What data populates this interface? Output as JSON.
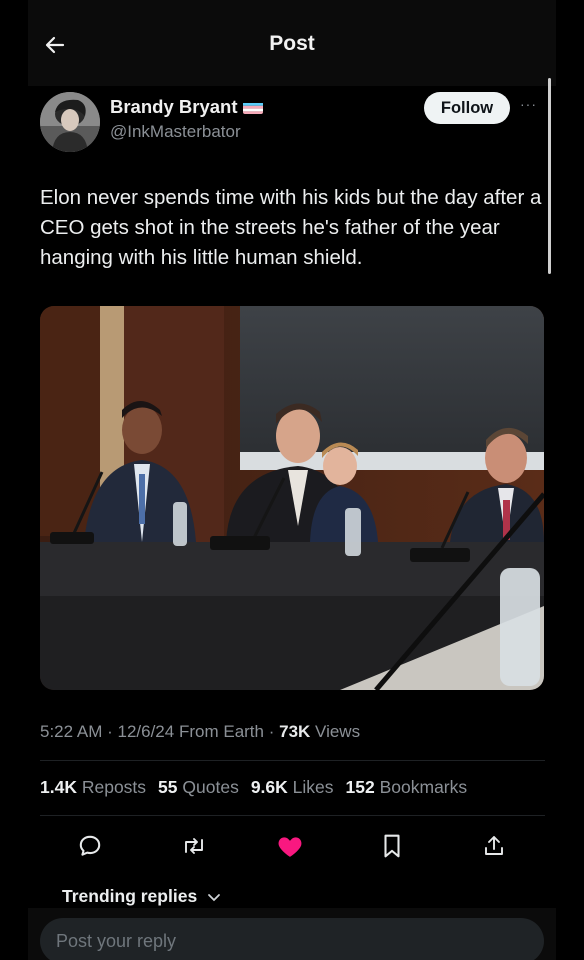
{
  "header": {
    "title": "Post"
  },
  "author": {
    "name": "Brandy Bryant",
    "handle": "@InkMasterbator",
    "follow_label": "Follow",
    "more_label": "···"
  },
  "tweet": {
    "text": "Elon never spends time with his kids but the day after a CEO gets shot in the streets he's father of the year hanging with his little human shield."
  },
  "meta": {
    "time": "5:22 AM",
    "date": "12/6/24",
    "source": "From Earth",
    "views_count": "73K",
    "views_label": "Views"
  },
  "stats": [
    {
      "count": "1.4K",
      "label": "Reposts"
    },
    {
      "count": "55",
      "label": "Quotes"
    },
    {
      "count": "9.6K",
      "label": "Likes"
    },
    {
      "count": "152",
      "label": "Bookmarks"
    }
  ],
  "replies": {
    "sort_label": "Trending replies",
    "placeholder": "Post your reply"
  },
  "colors": {
    "background": "#000000",
    "like_active": "#f91880",
    "muted_text": "#8b9096",
    "follow_button": "#eff3f4"
  }
}
